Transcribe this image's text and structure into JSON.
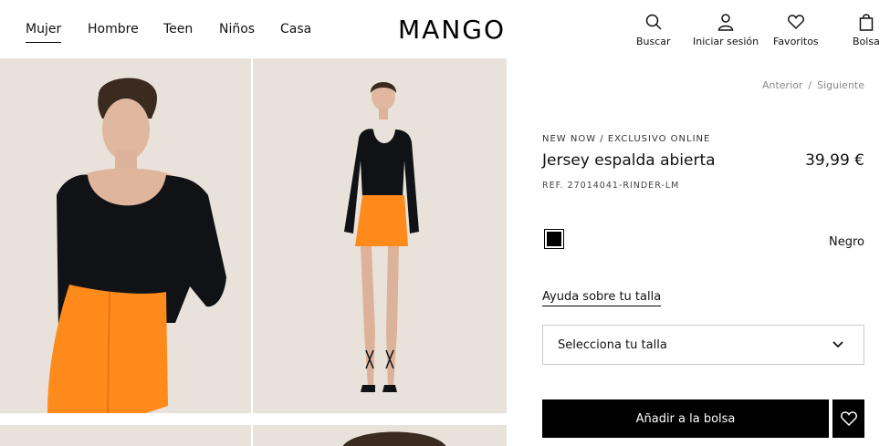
{
  "nav": {
    "items": [
      "Mujer",
      "Hombre",
      "Teen",
      "Niños",
      "Casa"
    ],
    "active": "Mujer"
  },
  "logo": "MANGO",
  "tools": {
    "search": "Buscar",
    "login": "Iniciar sesión",
    "favorites": "Favoritos",
    "bag": "Bolsa"
  },
  "breadcrumb": {
    "prev": "Anterior",
    "separator": "/",
    "next": "Siguiente"
  },
  "product": {
    "eyebrow": "NEW NOW / EXCLUSIVO ONLINE",
    "name": "Jersey espalda abierta",
    "price": "39,99 €",
    "ref": "REF. 27014041-RINDER-LM",
    "color": {
      "name": "Negro",
      "hex": "#000000"
    }
  },
  "size": {
    "help": "Ayuda sobre tu talla",
    "placeholder": "Selecciona tu talla"
  },
  "actions": {
    "add_to_bag": "Añadir a la bolsa"
  },
  "colors": {
    "photo_bg": "#e9e2da",
    "top": "#101216",
    "skirt": "#ff8a1c"
  }
}
